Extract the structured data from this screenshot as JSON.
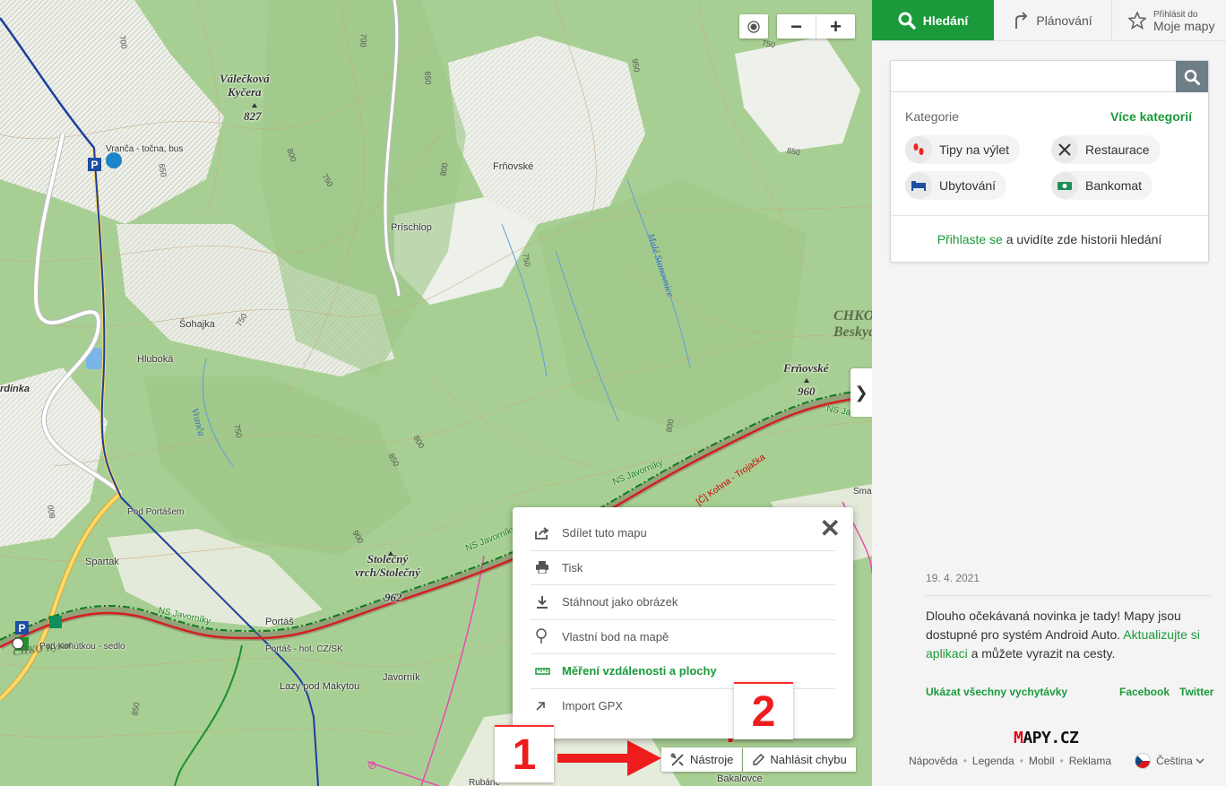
{
  "map": {
    "peaks": [
      {
        "name_line1": "Válečková",
        "name_line2": "Kyčera",
        "height": "827"
      },
      {
        "name_line1": "Frňovské",
        "name_line2": "",
        "height": "960"
      },
      {
        "name_line1": "Stolečný",
        "name_line2": "vrch/Stolečný",
        "height": "962"
      }
    ],
    "places": {
      "vranca": "Vranča - točna, bus",
      "frnovske": "Frňovské",
      "prischlop": "Príschlop",
      "sohajka": "Šohajka",
      "hluboka": "Hluboká",
      "ardinka": "rdinka",
      "pod_portasem": "Pod Portášem",
      "spartak": "Spartak",
      "portas": "Portáš",
      "portas_hot": "Portáš - hot. CZ/SK",
      "lazy": "Lazy pod Makytou",
      "javornik": "Javorník",
      "pod_kohutkou": "Pod Kohútkou - sedlo",
      "bakalovce": "Bakalovce",
      "sma": "Sma",
      "rubana": "Rubáne"
    },
    "chko_line1": "CHKO",
    "chko_line2": "Beskyd",
    "chko_left": "CHKO Kysuc",
    "streams": {
      "male": "Malé Stanovnice",
      "vranca": "Vranča"
    },
    "routes": {
      "ns1": "NS Javorníky",
      "ns2": "NS Javorníky",
      "ns3": "NS Javorníky",
      "ns4": "NS Javo",
      "ns5": "NS Javorníky",
      "red": "[Č] Kohna - Trojačka"
    },
    "contours": [
      "700",
      "650",
      "700",
      "800",
      "750",
      "650",
      "750",
      "800",
      "750",
      "800",
      "850",
      "750",
      "800",
      "850",
      "900",
      "950",
      "750",
      "800",
      "850"
    ],
    "controls": {
      "zoom_out": "−",
      "zoom_in": "+",
      "collapse": "❯"
    }
  },
  "tools_popup": {
    "close": "✕",
    "items": [
      {
        "label": "Sdílet tuto mapu",
        "icon": "share-icon"
      },
      {
        "label": "Tisk",
        "icon": "print-icon"
      },
      {
        "label": "Stáhnout jako obrázek",
        "icon": "download-icon"
      },
      {
        "label": "Vlastní bod na mapě",
        "icon": "pin-icon"
      },
      {
        "label": "Měření vzdálenosti a plochy",
        "icon": "ruler-icon"
      },
      {
        "label": "Import GPX",
        "icon": "import-icon"
      }
    ]
  },
  "bottom_tools": {
    "tools_label": "Nástroje",
    "report_label": "Nahlásit chybu"
  },
  "annotations": {
    "num1": "1",
    "num2": "2"
  },
  "panel": {
    "tabs": {
      "search": "Hledání",
      "plan": "Plánování",
      "my_small": "Přihlásit do",
      "my_big": "Moje mapy"
    },
    "search": {
      "placeholder": ""
    },
    "categories": {
      "heading": "Kategorie",
      "more": "Více kategorií",
      "items": [
        {
          "label": "Tipy na výlet",
          "icon": "footprints-icon"
        },
        {
          "label": "Restaurace",
          "icon": "cutlery-icon"
        },
        {
          "label": "Ubytování",
          "icon": "bed-icon"
        },
        {
          "label": "Bankomat",
          "icon": "atm-icon"
        }
      ]
    },
    "login": {
      "link": "Přihlaste se",
      "rest": " a uvidíte zde historii hledání"
    },
    "news": {
      "date": "19. 4. 2021",
      "text1": "Dlouho očekávaná novinka je tady! Mapy jsou dostupné pro systém Android Auto. ",
      "link": "Aktualizujte si aplikaci",
      "text2": " a můžete vyrazit na cesty.",
      "all": "Ukázat všechny vychytávky",
      "facebook": "Facebook",
      "twitter": "Twitter"
    },
    "logo": {
      "m": "M",
      "rest": "APY.CZ"
    },
    "footer": {
      "help": "Nápověda",
      "legend": "Legenda",
      "mobile": "Mobil",
      "ads": "Reklama",
      "language": "Čeština"
    }
  },
  "colors": {
    "accent": "#1a9a3a",
    "annotation_red": "#ee1c1c"
  }
}
